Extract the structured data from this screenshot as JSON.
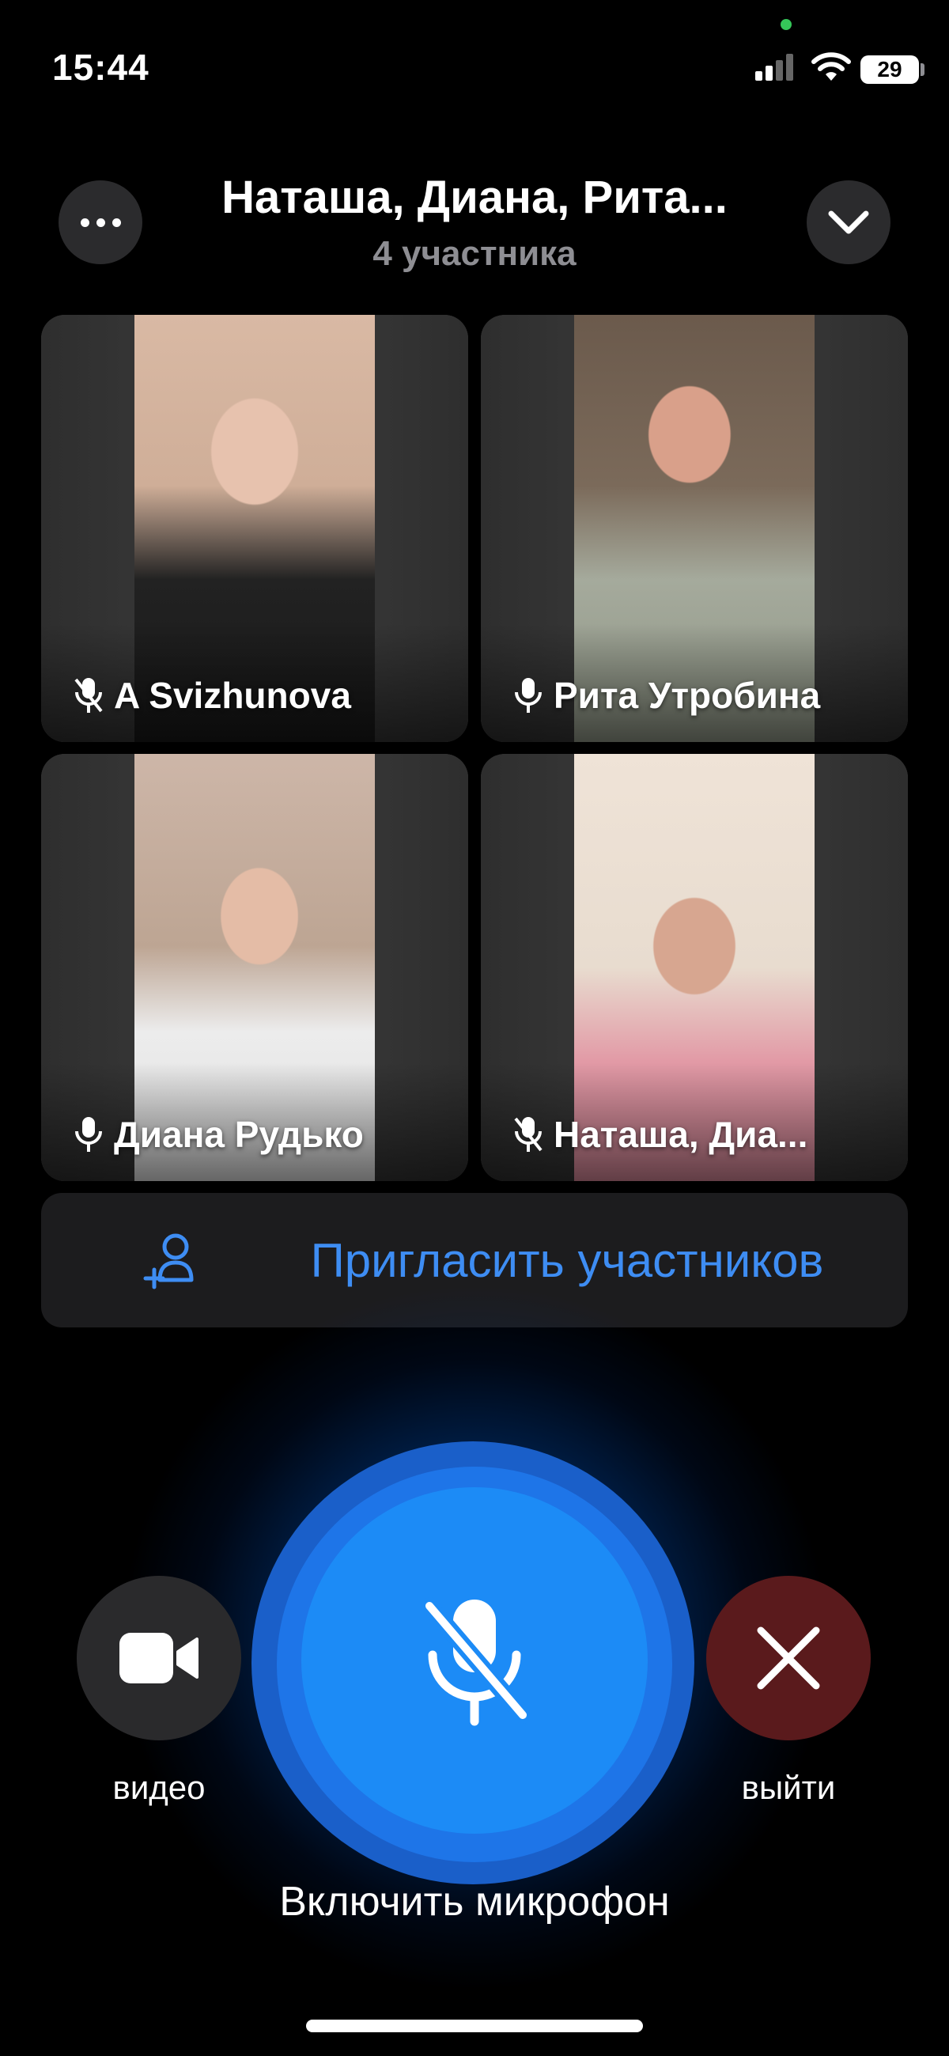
{
  "status_bar": {
    "time": "15:44",
    "battery": "29"
  },
  "header": {
    "title": "Наташа, Диана, Рита...",
    "subtitle": "4 участника"
  },
  "participants": [
    {
      "name": "A Svizhunova",
      "mic": "muted"
    },
    {
      "name": "Рита Утробина",
      "mic": "on"
    },
    {
      "name": "Диана Рудько",
      "mic": "on"
    },
    {
      "name": "Наташа, Диа...",
      "mic": "muted"
    }
  ],
  "invite": {
    "label": "Пригласить участников"
  },
  "controls": {
    "video_label": "видео",
    "leave_label": "выйти",
    "mic_label": "Включить микрофон"
  },
  "colors": {
    "accent": "#3e8df3",
    "mic_button": "#1c8bf6",
    "leave_button": "#5a1a1c"
  }
}
